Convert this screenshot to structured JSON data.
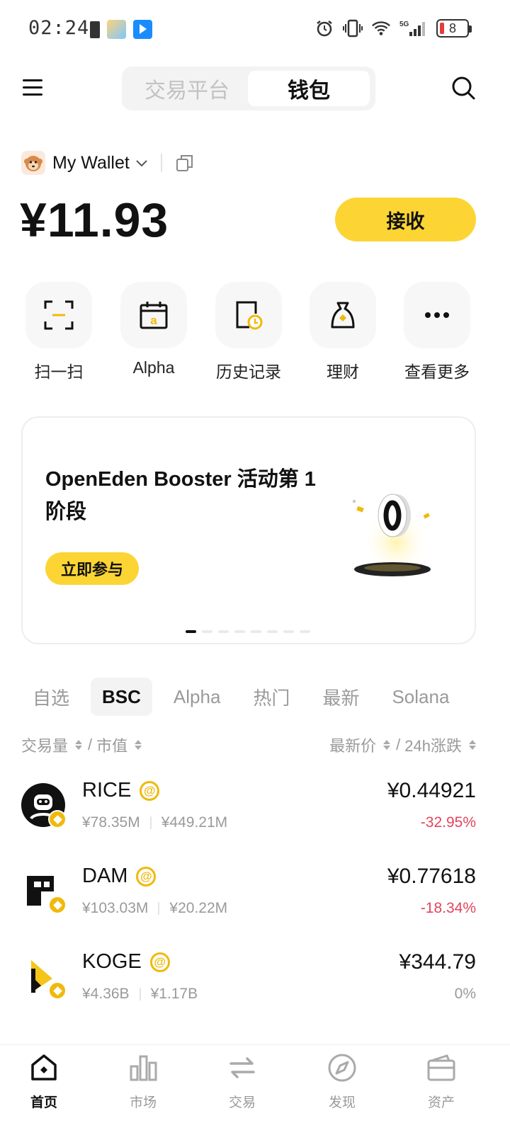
{
  "status_bar": {
    "time": "02:24",
    "battery_level": "8",
    "network": "5G"
  },
  "top_nav": {
    "tabs": [
      {
        "label": "交易平台",
        "active": false
      },
      {
        "label": "钱包",
        "active": true
      }
    ]
  },
  "wallet": {
    "name": "My Wallet",
    "balance": "¥11.93",
    "receive_label": "接收"
  },
  "shortcuts": [
    {
      "label": "扫一扫",
      "icon": "scan-icon"
    },
    {
      "label": "Alpha",
      "icon": "alpha-calendar-icon"
    },
    {
      "label": "历史记录",
      "icon": "history-icon"
    },
    {
      "label": "理财",
      "icon": "money-bag-icon"
    },
    {
      "label": "查看更多",
      "icon": "more-icon"
    }
  ],
  "banner": {
    "title": "OpenEden Booster 活动第 1 阶段",
    "button": "立即参与",
    "dots": 8,
    "active_dot": 0
  },
  "market_tabs": [
    {
      "label": "自选",
      "active": false
    },
    {
      "label": "BSC",
      "active": true
    },
    {
      "label": "Alpha",
      "active": false
    },
    {
      "label": "热门",
      "active": false
    },
    {
      "label": "最新",
      "active": false
    },
    {
      "label": "Solana",
      "active": false
    }
  ],
  "sort_header": {
    "left_a": "交易量",
    "left_b": "市值",
    "right_a": "最新价",
    "right_b": "24h涨跌"
  },
  "tokens": [
    {
      "symbol": "RICE",
      "volume": "¥78.35M",
      "market_cap": "¥449.21M",
      "price": "¥0.44921",
      "change": "-32.95%",
      "change_dir": "neg"
    },
    {
      "symbol": "DAM",
      "volume": "¥103.03M",
      "market_cap": "¥20.22M",
      "price": "¥0.77618",
      "change": "-18.34%",
      "change_dir": "neg"
    },
    {
      "symbol": "KOGE",
      "volume": "¥4.36B",
      "market_cap": "¥1.17B",
      "price": "¥344.79",
      "change": "0%",
      "change_dir": "zero"
    }
  ],
  "bottom_nav": [
    {
      "label": "首页",
      "icon": "home-icon",
      "active": true
    },
    {
      "label": "市场",
      "icon": "market-chart-icon",
      "active": false
    },
    {
      "label": "交易",
      "icon": "trade-swap-icon",
      "active": false
    },
    {
      "label": "发现",
      "icon": "discover-compass-icon",
      "active": false
    },
    {
      "label": "资产",
      "icon": "assets-wallet-icon",
      "active": false
    }
  ],
  "colors": {
    "accent_yellow": "#fcd535",
    "binance_gold": "#f0b90b",
    "negative_red": "#e0465e",
    "muted_gray": "#9a9a9a"
  }
}
